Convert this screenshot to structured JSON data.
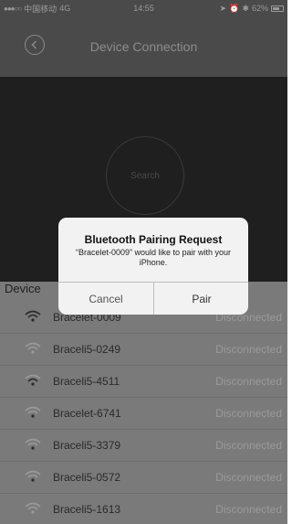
{
  "status_bar": {
    "carrier": "中国移动",
    "network": "4G",
    "time": "14:55",
    "battery": "62%"
  },
  "nav": {
    "title": "Device Connection"
  },
  "search": {
    "label": "Search"
  },
  "devices": {
    "heading": "Device",
    "items": [
      {
        "name": "Bracelet-0009",
        "status": "Disconnected"
      },
      {
        "name": "Braceli5-0249",
        "status": "Disconnected"
      },
      {
        "name": "Braceli5-4511",
        "status": "Disconnected"
      },
      {
        "name": "Bracelet-6741",
        "status": "Disconnected"
      },
      {
        "name": "Braceli5-3379",
        "status": "Disconnected"
      },
      {
        "name": "Braceli5-0572",
        "status": "Disconnected"
      },
      {
        "name": "Braceli5-1613",
        "status": "Disconnected"
      }
    ]
  },
  "dialog": {
    "title": "Bluetooth Pairing Request",
    "message": "“Bracelet-0009” would like to pair with your iPhone.",
    "cancel": "Cancel",
    "pair": "Pair"
  }
}
